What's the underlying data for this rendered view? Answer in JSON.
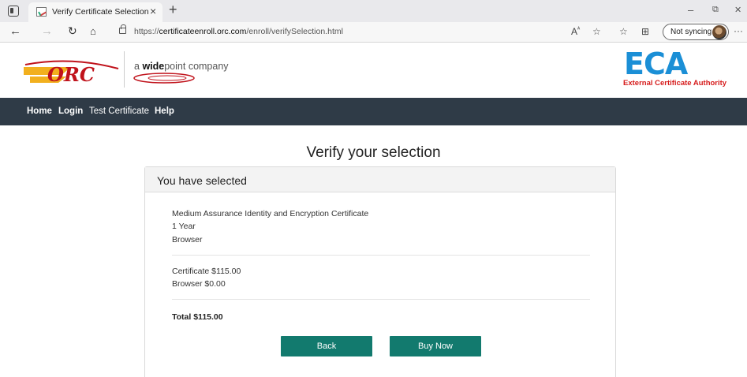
{
  "browser": {
    "tab_title": "Verify Certificate Selection",
    "tab_close": "×",
    "new_tab": "+",
    "url_prefix": "https://",
    "url_host": "certificateenroll.orc.com",
    "url_path": "/enroll/verifySelection.html",
    "sync_label": "Not syncing",
    "controls": {
      "minimize": "–",
      "restore": "⧉",
      "close": "✕"
    },
    "toolbar_icons": [
      "read-aloud-icon",
      "favorites-add-icon",
      "favorites-icon",
      "collections-icon"
    ]
  },
  "header": {
    "brand_text_prefix": "a ",
    "brand_text_bold": "wide",
    "brand_text_suffix": "point company",
    "eca_logo": "ECA",
    "eca_subtitle": "External Certificate Authority",
    "colors": {
      "eca_blue": "#1b8fd6",
      "eca_red": "#d61b1b",
      "orc_gold": "#f2b01e",
      "orc_red": "#c0121b"
    }
  },
  "nav": {
    "home": "Home",
    "login": "Login",
    "test_certificate": "Test Certificate",
    "help": "Help",
    "background": "#2f3b47"
  },
  "main": {
    "title": "Verify your selection",
    "card_header": "You have selected",
    "selection": [
      "Medium Assurance Identity and Encryption Certificate",
      "1 Year",
      "Browser"
    ],
    "pricing": [
      "Certificate $115.00",
      "Browser $0.00"
    ],
    "total": "Total $115.00",
    "back_label": "Back",
    "buy_label": "Buy Now",
    "button_color": "#127a6e"
  }
}
